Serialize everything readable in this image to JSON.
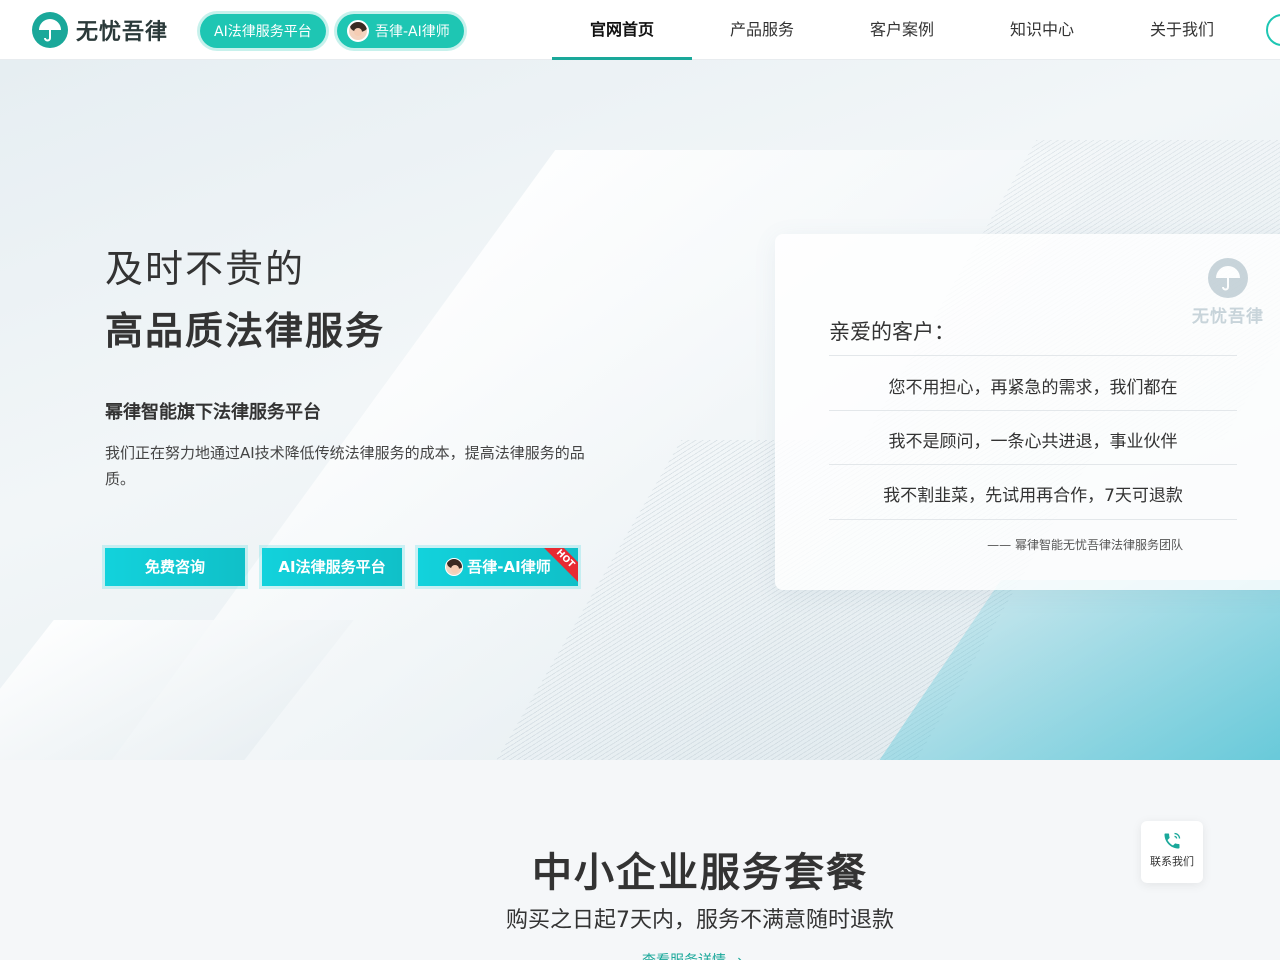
{
  "header": {
    "logo_text": "无忧吾律",
    "pill_platform": "AI法律服务平台",
    "pill_lawyer": "吾律-AI律师",
    "nav": [
      "官网首页",
      "产品服务",
      "客户案例",
      "知识中心",
      "关于我们"
    ],
    "active_nav": "官网首页"
  },
  "hero": {
    "title_line1": "及时不贵的",
    "title_line2": "高品质法律服务",
    "subtitle": "幂律智能旗下法律服务平台",
    "description": "我们正在努力地通过AI技术降低传统法律服务的成本，提高法律服务的品质。",
    "buttons": {
      "consult": "免费咨询",
      "platform": "AI法律服务平台",
      "lawyer": "吾律-AI律师",
      "hot_badge": "HOT"
    }
  },
  "card": {
    "watermark": "无忧吾律",
    "greeting": "亲爱的客户：",
    "rows": [
      "您不用担心，再紧急的需求，我们都在",
      "我不是顾问，一条心共进退，事业伙伴",
      "我不割韭菜，先试用再合作，7天可退款"
    ],
    "signature": "—— 幂律智能无忧吾律法律服务团队"
  },
  "section": {
    "title": "中小企业服务套餐",
    "subtitle": "购买之日起7天内，服务不满意随时退款",
    "link": "查看服务详情 →"
  },
  "contact": {
    "label": "联系我们",
    "icon": "phone-icon"
  },
  "colors": {
    "brand": "#1aa89a",
    "accent": "#12d2dc",
    "hot": "#e82a32"
  }
}
